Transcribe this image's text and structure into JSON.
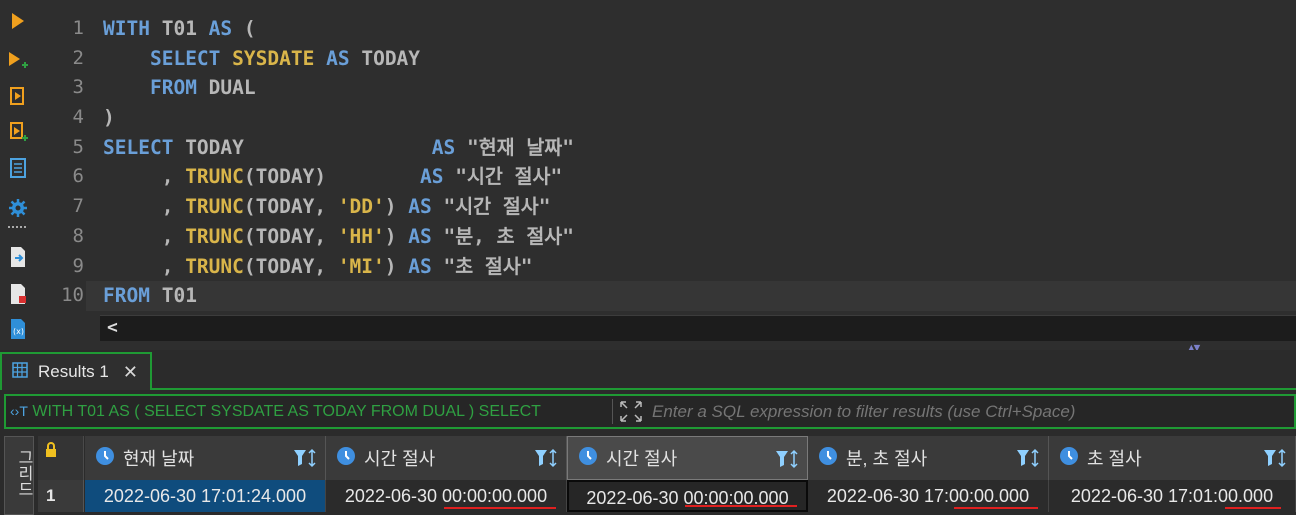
{
  "editor": {
    "line_numbers": [
      "1",
      "2",
      "3",
      "4",
      "5",
      "6",
      "7",
      "8",
      "9",
      "10"
    ],
    "lines": [
      [
        [
          "kw",
          "WITH"
        ],
        [
          "txt",
          " T01 "
        ],
        [
          "kw",
          "AS"
        ],
        [
          "txt",
          " ("
        ]
      ],
      [
        [
          "txt",
          "    "
        ],
        [
          "kw",
          "SELECT"
        ],
        [
          "txt",
          " "
        ],
        [
          "fn",
          "SYSDATE"
        ],
        [
          "txt",
          " "
        ],
        [
          "kw",
          "AS"
        ],
        [
          "txt",
          " TODAY"
        ]
      ],
      [
        [
          "txt",
          "    "
        ],
        [
          "kw",
          "FROM"
        ],
        [
          "txt",
          " DUAL"
        ]
      ],
      [
        [
          "txt",
          ")"
        ]
      ],
      [
        [
          "kw",
          "SELECT"
        ],
        [
          "txt",
          " TODAY                "
        ],
        [
          "kw",
          "AS"
        ],
        [
          "txt",
          " \"현재 날짜\""
        ]
      ],
      [
        [
          "txt",
          "     , "
        ],
        [
          "fn",
          "TRUNC"
        ],
        [
          "txt",
          "(TODAY)        "
        ],
        [
          "kw",
          "AS"
        ],
        [
          "txt",
          " \"시간 절사\""
        ]
      ],
      [
        [
          "txt",
          "     , "
        ],
        [
          "fn",
          "TRUNC"
        ],
        [
          "txt",
          "(TODAY, "
        ],
        [
          "str",
          "'DD'"
        ],
        [
          "txt",
          ") "
        ],
        [
          "kw",
          "AS"
        ],
        [
          "txt",
          " \"시간 절사\""
        ]
      ],
      [
        [
          "txt",
          "     , "
        ],
        [
          "fn",
          "TRUNC"
        ],
        [
          "txt",
          "(TODAY, "
        ],
        [
          "str",
          "'HH'"
        ],
        [
          "txt",
          ") "
        ],
        [
          "kw",
          "AS"
        ],
        [
          "txt",
          " \"분, 초 절사\""
        ]
      ],
      [
        [
          "txt",
          "     , "
        ],
        [
          "fn",
          "TRUNC"
        ],
        [
          "txt",
          "(TODAY, "
        ],
        [
          "str",
          "'MI'"
        ],
        [
          "txt",
          ") "
        ],
        [
          "kw",
          "AS"
        ],
        [
          "txt",
          " \"초 절사\""
        ]
      ],
      [
        [
          "kw",
          "FROM"
        ],
        [
          "txt",
          " T01"
        ]
      ]
    ],
    "scroll_left_glyph": "<"
  },
  "results": {
    "tab_label": "Results 1",
    "close_glyph": "✕",
    "filter_query": "WITH T01 AS ( SELECT SYSDATE AS TODAY FROM DUAL ) SELECT",
    "filter_placeholder": "Enter a SQL expression to filter results (use Ctrl+Space)",
    "vertical_tab_label": "그리드",
    "columns": [
      "현재 날짜",
      "시간 절사",
      "시간 절사",
      "분, 초 절사",
      "초 절사"
    ],
    "rows": [
      {
        "row_number": "1",
        "cells": [
          "2022-06-30 17:01:24.000",
          "2022-06-30 00:00:00.000",
          "2022-06-30 00:00:00.000",
          "2022-06-30 17:00:00.000",
          "2022-06-30 17:01:00.000"
        ]
      }
    ]
  },
  "colors": {
    "keyword": "#6a9fd8",
    "function": "#d9b54a",
    "accent_green": "#1f9a34",
    "selected_cell": "#0f4c7d",
    "underline_red": "#e02020"
  }
}
